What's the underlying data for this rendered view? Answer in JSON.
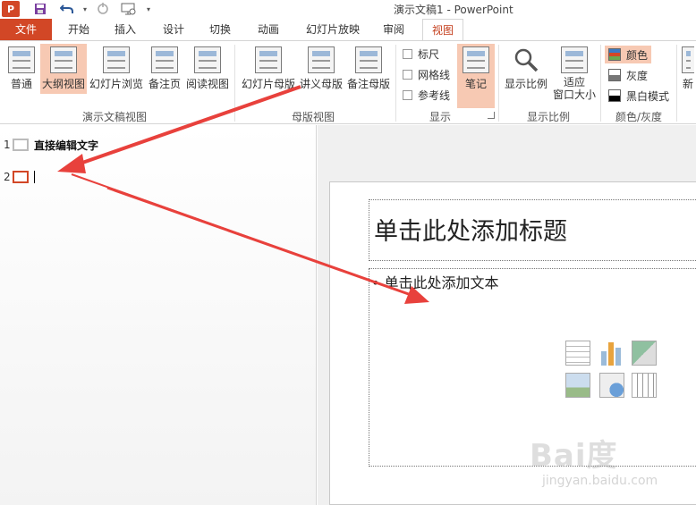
{
  "app": {
    "logo_text": "P",
    "window_title": "演示文稿1 - PowerPoint"
  },
  "quick_access": {
    "save_icon": "save-icon",
    "undo_icon": "undo-icon",
    "redo_icon": "redo-icon",
    "present_icon": "presentation-icon"
  },
  "tabs": [
    {
      "label": "文件"
    },
    {
      "label": "开始"
    },
    {
      "label": "插入"
    },
    {
      "label": "设计"
    },
    {
      "label": "切换"
    },
    {
      "label": "动画"
    },
    {
      "label": "幻灯片放映"
    },
    {
      "label": "审阅"
    },
    {
      "label": "视图"
    }
  ],
  "ribbon": {
    "presentation_views": {
      "group_label": "演示文稿视图",
      "buttons": [
        "普通",
        "大纲视图",
        "幻灯片浏览",
        "备注页",
        "阅读视图"
      ]
    },
    "master_views": {
      "group_label": "母版视图",
      "buttons": [
        "幻灯片母版",
        "讲义母版",
        "备注母版"
      ]
    },
    "show": {
      "group_label": "显示",
      "checkboxes": [
        "标尺",
        "网格线",
        "参考线"
      ],
      "notes_label": "笔记"
    },
    "zoom": {
      "group_label": "显示比例",
      "zoom_label": "显示比例",
      "fit_label_line1": "适应",
      "fit_label_line2": "窗口大小"
    },
    "color": {
      "group_label": "颜色/灰度",
      "options": [
        "颜色",
        "灰度",
        "黑白模式"
      ]
    },
    "new_window_partial": "新"
  },
  "outline": {
    "slides": [
      {
        "number": "1",
        "text": "直接编辑文字"
      },
      {
        "number": "2",
        "text": ""
      }
    ]
  },
  "slide": {
    "title_placeholder": "单击此处添加标题",
    "body_placeholder": "• 单击此处添加文本"
  },
  "watermark": {
    "text": "Bai度",
    "sub": "jingyan.baidu.com"
  },
  "colors": {
    "accent": "#d24726",
    "selected_bg": "#f7c9b3",
    "arrow": "#e8413c"
  }
}
